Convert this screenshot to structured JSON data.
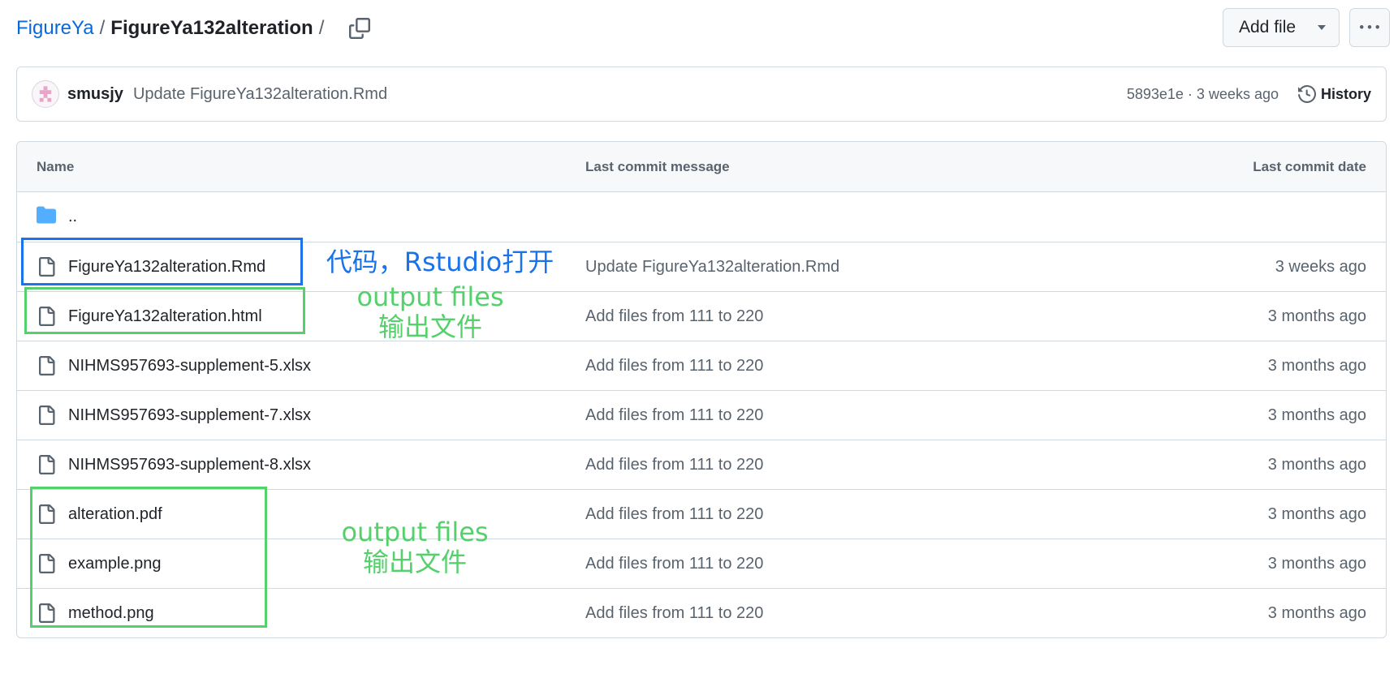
{
  "breadcrumb": {
    "root": "FigureYa",
    "separator": "/",
    "current": "FigureYa132alteration",
    "trailing_separator": "/"
  },
  "header": {
    "copy_icon": "copy-icon",
    "add_file_label": "Add file",
    "more_icon": "kebab-horizontal-icon"
  },
  "commit": {
    "author": "smusjy",
    "message": "Update FigureYa132alteration.Rmd",
    "meta": "5893e1e · 3 weeks ago",
    "history_label": "History"
  },
  "table": {
    "headers": {
      "name": "Name",
      "message": "Last commit message",
      "date": "Last commit date"
    },
    "parent_row": {
      "name": "..",
      "icon": "folder-icon"
    },
    "rows": [
      {
        "name": "FigureYa132alteration.Rmd",
        "message": "Update FigureYa132alteration.Rmd",
        "date": "3 weeks ago",
        "icon": "file-icon"
      },
      {
        "name": "FigureYa132alteration.html",
        "message": "Add files from 111 to 220",
        "date": "3 months ago",
        "icon": "file-icon"
      },
      {
        "name": "NIHMS957693-supplement-5.xlsx",
        "message": "Add files from 111 to 220",
        "date": "3 months ago",
        "icon": "file-icon"
      },
      {
        "name": "NIHMS957693-supplement-7.xlsx",
        "message": "Add files from 111 to 220",
        "date": "3 months ago",
        "icon": "file-icon"
      },
      {
        "name": "NIHMS957693-supplement-8.xlsx",
        "message": "Add files from 111 to 220",
        "date": "3 months ago",
        "icon": "file-icon"
      },
      {
        "name": "alteration.pdf",
        "message": "Add files from 111 to 220",
        "date": "3 months ago",
        "icon": "file-icon"
      },
      {
        "name": "example.png",
        "message": "Add files from 111 to 220",
        "date": "3 months ago",
        "icon": "file-icon"
      },
      {
        "name": "method.png",
        "message": "Add files from 111 to 220",
        "date": "3 months ago",
        "icon": "file-icon"
      }
    ]
  },
  "annotations": {
    "code": "代码，Rstudio打开",
    "output_en": "output files",
    "output_zh": "输出文件",
    "colors": {
      "blue": "#1a73e8",
      "green": "#55d16b"
    }
  }
}
